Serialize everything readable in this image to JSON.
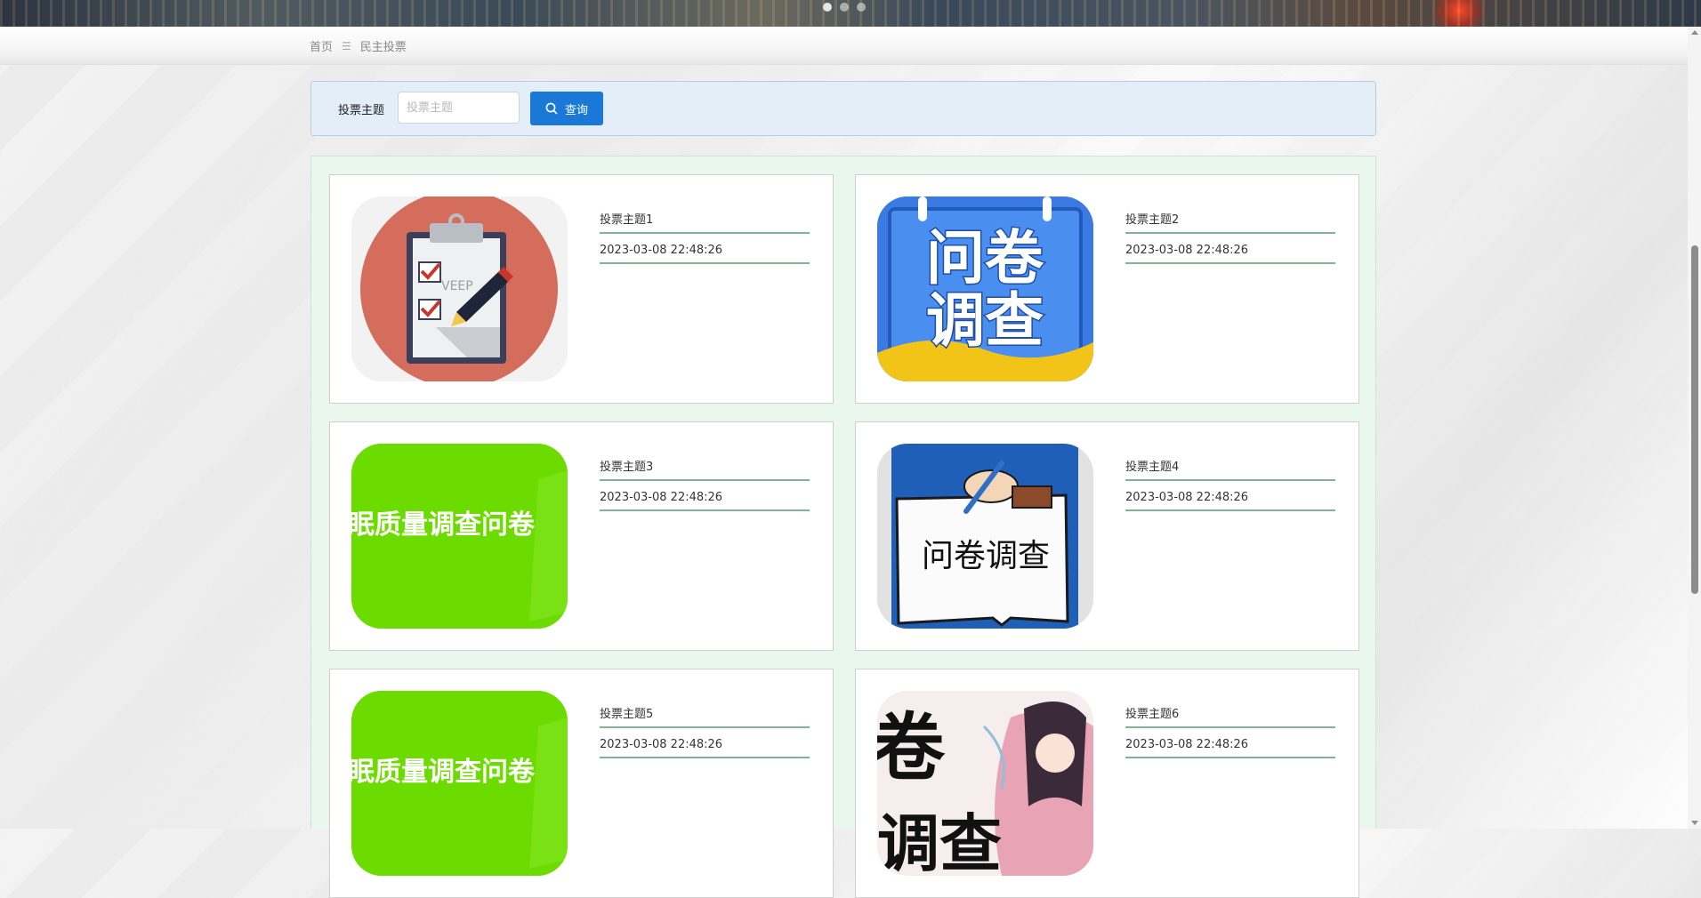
{
  "breadcrumb": {
    "home": "首页",
    "separator": "☰",
    "current": "民主投票"
  },
  "search": {
    "label": "投票主题",
    "placeholder": "投票主题",
    "value": "",
    "button_label": "查询",
    "button_color": "#1a78d6"
  },
  "items": [
    {
      "title": "投票主题1",
      "date": "2023-03-08 22:48:26",
      "image_text": "VEEP"
    },
    {
      "title": "投票主题2",
      "date": "2023-03-08 22:48:26",
      "image_text_line1": "问卷",
      "image_text_line2": "调查"
    },
    {
      "title": "投票主题3",
      "date": "2023-03-08 22:48:26",
      "image_text": "眠质量调查问卷"
    },
    {
      "title": "投票主题4",
      "date": "2023-03-08 22:48:26",
      "image_text": "问卷调查"
    },
    {
      "title": "投票主题5",
      "date": "2023-03-08 22:48:26",
      "image_text": "眠质量调查问卷"
    },
    {
      "title": "投票主题6",
      "date": "2023-03-08 22:48:26",
      "image_text_line1": "卷",
      "image_text_line2": "调查"
    }
  ],
  "colors": {
    "accent_green_line": "#7fb592",
    "search_bg": "#e4eef8",
    "list_bg": "#e9f7ec"
  }
}
